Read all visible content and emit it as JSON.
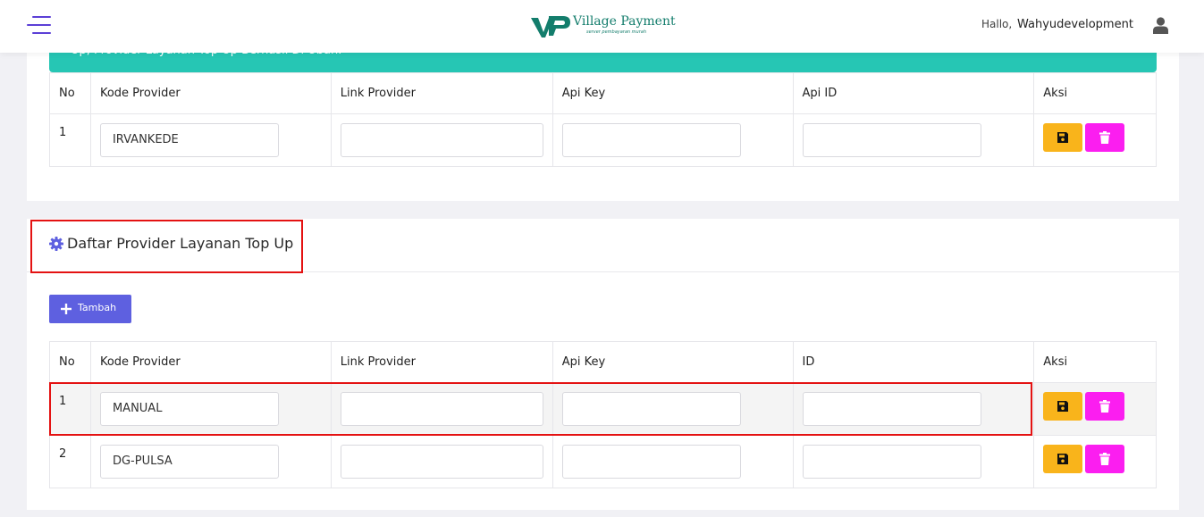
{
  "header": {
    "brand": "Village Payment",
    "tagline": "server pembayaran murah",
    "greeting": "Hallo,",
    "username": "Wahyudevelopment",
    "accent_color": "#5b3fd6"
  },
  "alert": {
    "text": "Up, Provider Layanan Top Up Berhasil Di Ubah.",
    "color": "#26c6b4"
  },
  "table1": {
    "headers": [
      "No",
      "Kode Provider",
      "Link Provider",
      "Api Key",
      "Api ID",
      "Aksi"
    ],
    "rows": [
      {
        "no": "1",
        "kode": "IRVANKEDE",
        "link": "",
        "api_key": "",
        "api_id": ""
      }
    ]
  },
  "section": {
    "title": "Daftar Provider Layanan Top Up",
    "add_label": "Tambah"
  },
  "table2": {
    "headers": [
      "No",
      "Kode Provider",
      "Link Provider",
      "Api Key",
      "ID",
      "Aksi"
    ],
    "rows": [
      {
        "no": "1",
        "kode": "MANUAL",
        "link": "",
        "api_key": "",
        "api_id": ""
      },
      {
        "no": "2",
        "kode": "DG-PULSA",
        "link": "",
        "api_key": "",
        "api_id": ""
      }
    ]
  },
  "colors": {
    "save_button": "#f9b41b",
    "delete_button": "#fb1ef0",
    "add_button": "#5e60e0",
    "highlight_box": "#e41212"
  },
  "icons": [
    "hamburger-icon",
    "user-icon",
    "gear-icon",
    "plus-icon",
    "floppy-disk-icon",
    "trash-icon"
  ]
}
